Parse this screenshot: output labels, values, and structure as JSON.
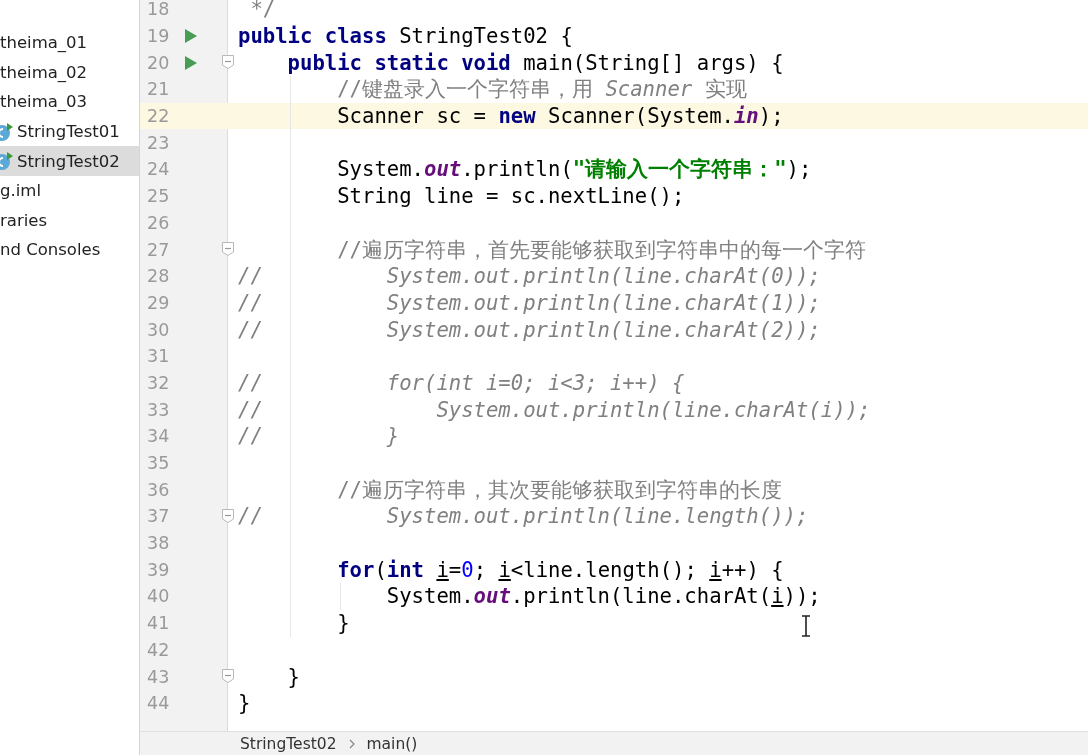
{
  "project_tree": {
    "items": [
      {
        "label": "theima_01",
        "kind": "folder",
        "selected": false
      },
      {
        "label": "theima_02",
        "kind": "folder",
        "selected": false
      },
      {
        "label": "theima_03",
        "kind": "folder",
        "selected": false
      },
      {
        "label": "StringTest01",
        "kind": "class",
        "selected": false
      },
      {
        "label": "StringTest02",
        "kind": "class",
        "selected": true
      },
      {
        "label": "g.iml",
        "kind": "file",
        "selected": false
      },
      {
        "label": "raries",
        "kind": "file",
        "selected": false
      },
      {
        "label": "nd Consoles",
        "kind": "file",
        "selected": false
      }
    ]
  },
  "editor": {
    "lines": [
      {
        "number": "18",
        "run": false,
        "fold": false,
        "current": false,
        "tokens": [
          {
            "kind": "comment",
            "text": " */"
          }
        ]
      },
      {
        "number": "19",
        "run": true,
        "fold": false,
        "current": false,
        "tokens": [
          {
            "kind": "keyword",
            "text": "public class"
          },
          {
            "kind": "plain",
            "text": " StringTest02 {"
          }
        ]
      },
      {
        "number": "20",
        "run": true,
        "fold": true,
        "current": false,
        "tokens": [
          {
            "kind": "keyword",
            "text": "    public static void"
          },
          {
            "kind": "plain",
            "text": " main(String[] args) {"
          }
        ]
      },
      {
        "number": "21",
        "run": false,
        "fold": false,
        "current": false,
        "tokens": [
          {
            "kind": "comment",
            "text": "        //键盘录入一个字符串，用 "
          },
          {
            "kind": "doc",
            "text": "Scanner"
          },
          {
            "kind": "comment",
            "text": " 实现"
          }
        ]
      },
      {
        "number": "22",
        "run": false,
        "fold": false,
        "current": true,
        "tokens": [
          {
            "kind": "plain",
            "text": "        Scanner sc = "
          },
          {
            "kind": "keyword",
            "text": "new"
          },
          {
            "kind": "plain",
            "text": " Scanner(System."
          },
          {
            "kind": "field",
            "text": "in"
          },
          {
            "kind": "plain",
            "text": ");"
          }
        ]
      },
      {
        "number": "23",
        "run": false,
        "fold": false,
        "current": false
      },
      {
        "number": "24",
        "run": false,
        "fold": false,
        "current": false,
        "tokens": [
          {
            "kind": "plain",
            "text": "        System."
          },
          {
            "kind": "field",
            "text": "out"
          },
          {
            "kind": "plain",
            "text": ".println("
          },
          {
            "kind": "string",
            "text": "\"请输入一个字符串：\""
          },
          {
            "kind": "plain",
            "text": ");"
          }
        ]
      },
      {
        "number": "25",
        "run": false,
        "fold": false,
        "current": false,
        "tokens": [
          {
            "kind": "plain",
            "text": "        String line = sc.nextLine();"
          }
        ]
      },
      {
        "number": "26",
        "run": false,
        "fold": false,
        "current": false
      },
      {
        "number": "27",
        "run": false,
        "fold": true,
        "current": false,
        "tokens": [
          {
            "kind": "comment",
            "text": "        //遍历字符串，首先要能够获取到字符串中的每一个字符"
          }
        ]
      },
      {
        "number": "28",
        "run": false,
        "fold": false,
        "current": false,
        "tokens": [
          {
            "kind": "doc",
            "text": "//          System.out.println(line.charAt(0));"
          }
        ]
      },
      {
        "number": "29",
        "run": false,
        "fold": false,
        "current": false,
        "tokens": [
          {
            "kind": "doc",
            "text": "//          System.out.println(line.charAt(1));"
          }
        ]
      },
      {
        "number": "30",
        "run": false,
        "fold": false,
        "current": false,
        "tokens": [
          {
            "kind": "doc",
            "text": "//          System.out.println(line.charAt(2));"
          }
        ]
      },
      {
        "number": "31",
        "run": false,
        "fold": false,
        "current": false
      },
      {
        "number": "32",
        "run": false,
        "fold": false,
        "current": false,
        "tokens": [
          {
            "kind": "doc",
            "text": "//          for(int i=0; i<3; i++) {"
          }
        ]
      },
      {
        "number": "33",
        "run": false,
        "fold": false,
        "current": false,
        "tokens": [
          {
            "kind": "doc",
            "text": "//              System.out.println(line.charAt(i));"
          }
        ]
      },
      {
        "number": "34",
        "run": false,
        "fold": false,
        "current": false,
        "tokens": [
          {
            "kind": "doc",
            "text": "//          }"
          }
        ]
      },
      {
        "number": "35",
        "run": false,
        "fold": false,
        "current": false
      },
      {
        "number": "36",
        "run": false,
        "fold": false,
        "current": false,
        "tokens": [
          {
            "kind": "comment",
            "text": "        //遍历字符串，其次要能够获取到字符串的长度"
          }
        ]
      },
      {
        "number": "37",
        "run": false,
        "fold": true,
        "current": false,
        "tokens": [
          {
            "kind": "doc",
            "text": "//          System.out.println(line.length());"
          }
        ]
      },
      {
        "number": "38",
        "run": false,
        "fold": false,
        "current": false
      },
      {
        "number": "39",
        "run": false,
        "fold": false,
        "current": false,
        "tokens": [
          {
            "kind": "keyword",
            "text": "        for"
          },
          {
            "kind": "plain",
            "text": "("
          },
          {
            "kind": "keyword",
            "text": "int "
          },
          {
            "kind": "var",
            "text": "i"
          },
          {
            "kind": "plain",
            "text": "="
          },
          {
            "kind": "number",
            "text": "0"
          },
          {
            "kind": "plain",
            "text": "; "
          },
          {
            "kind": "var",
            "text": "i"
          },
          {
            "kind": "plain",
            "text": "<line.length(); "
          },
          {
            "kind": "var",
            "text": "i"
          },
          {
            "kind": "plain",
            "text": "++) {"
          }
        ]
      },
      {
        "number": "40",
        "run": false,
        "fold": false,
        "current": false,
        "tokens": [
          {
            "kind": "plain",
            "text": "            System."
          },
          {
            "kind": "field",
            "text": "out"
          },
          {
            "kind": "plain",
            "text": ".println(line.charAt("
          },
          {
            "kind": "var",
            "text": "i"
          },
          {
            "kind": "plain",
            "text": "));"
          }
        ]
      },
      {
        "number": "41",
        "run": false,
        "fold": false,
        "current": false,
        "tokens": [
          {
            "kind": "plain",
            "text": "        }"
          }
        ]
      },
      {
        "number": "42",
        "run": false,
        "fold": false,
        "current": false
      },
      {
        "number": "43",
        "run": false,
        "fold": true,
        "current": false,
        "tokens": [
          {
            "kind": "plain",
            "text": "    }"
          }
        ]
      },
      {
        "number": "44",
        "run": false,
        "fold": false,
        "current": false,
        "tokens": [
          {
            "kind": "plain",
            "text": "}"
          }
        ]
      }
    ]
  },
  "breadcrumb": [
    "StringTest02",
    "main()"
  ]
}
